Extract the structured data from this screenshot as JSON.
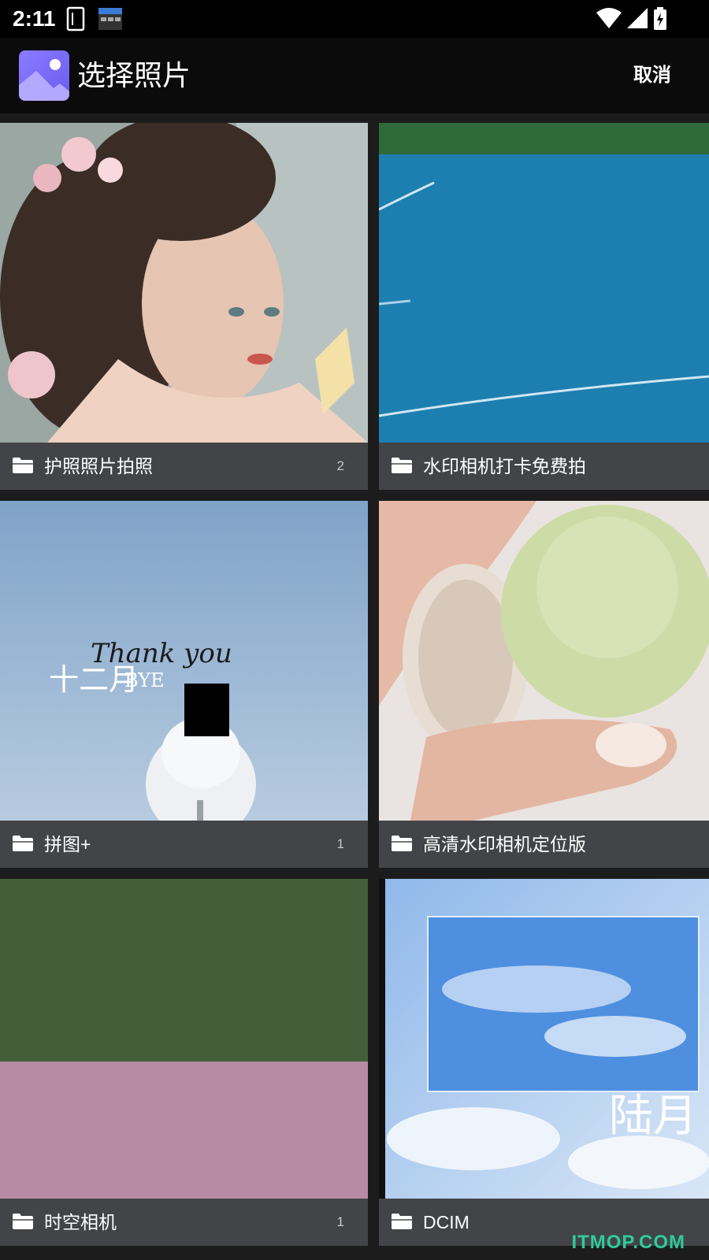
{
  "status_bar": {
    "time": "2:11",
    "icons": [
      "sim-card-icon",
      "calendar-widget-icon",
      "wifi-icon",
      "signal-icon",
      "battery-charging-icon"
    ]
  },
  "app_bar": {
    "title": "选择照片",
    "cancel_label": "取消",
    "logo_icon": "gallery-image-icon"
  },
  "albums": [
    {
      "name": "护照照片拍照",
      "count": "2",
      "thumb": "portrait-woman-flowers"
    },
    {
      "name": "水印相机打卡免费拍",
      "count": "",
      "thumb": "blue-water"
    },
    {
      "name": "拼图+",
      "count": "1",
      "thumb": "thank-you-snow-tree"
    },
    {
      "name": "高清水印相机定位版",
      "count": "",
      "thumb": "hand-holding-mochi"
    },
    {
      "name": "时空相机",
      "count": "1",
      "thumb": "green-pink-blocks"
    },
    {
      "name": "DCIM",
      "count": "",
      "thumb": "sky-clouds-luyue"
    }
  ],
  "thumb_texts": {
    "thank_you": "Thank you",
    "december": "十二月",
    "bye": "BYE",
    "luyue": "陆月"
  },
  "watermark": "ITMOP.COM",
  "colors": {
    "accent_logo": "#7c6cf6",
    "label_bar": "#46484c",
    "watermark": "#2ecc9a"
  }
}
